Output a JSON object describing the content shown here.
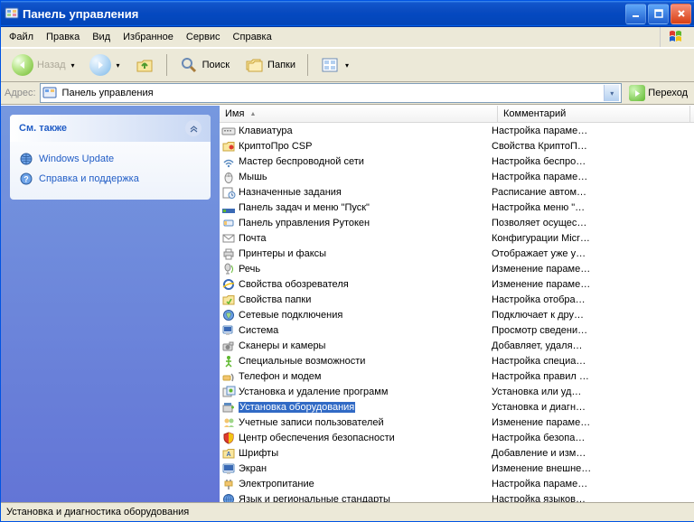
{
  "window": {
    "title": "Панель управления"
  },
  "menubar": [
    "Файл",
    "Правка",
    "Вид",
    "Избранное",
    "Сервис",
    "Справка"
  ],
  "toolbar": {
    "back": "Назад",
    "search": "Поиск",
    "folders": "Папки"
  },
  "addressbar": {
    "label": "Адрес:",
    "value": "Панель управления",
    "go": "Переход"
  },
  "sidebar": {
    "panel": {
      "title": "См. также",
      "links": [
        {
          "label": "Windows Update",
          "icon": "globe"
        },
        {
          "label": "Справка и поддержка",
          "icon": "help"
        }
      ]
    }
  },
  "columns": {
    "name": "Имя",
    "comment": "Комментарий",
    "name_w": 295,
    "comment_w": 200
  },
  "selected_index": 18,
  "items": [
    {
      "name": "Клавиатура",
      "comment": "Настройка параме…",
      "icon": "keyboard"
    },
    {
      "name": "КриптоПро CSP",
      "comment": "Свойства КриптоП…",
      "icon": "folder-cert"
    },
    {
      "name": "Мастер беспроводной сети",
      "comment": "Настройка беспро…",
      "icon": "wifi"
    },
    {
      "name": "Мышь",
      "comment": "Настройка параме…",
      "icon": "mouse"
    },
    {
      "name": "Назначенные задания",
      "comment": "Расписание автом…",
      "icon": "tasks"
    },
    {
      "name": "Панель задач и меню \"Пуск\"",
      "comment": "Настройка меню \"…",
      "icon": "taskbar"
    },
    {
      "name": "Панель управления Рутокен",
      "comment": "Позволяет осущес…",
      "icon": "rutoken"
    },
    {
      "name": "Почта",
      "comment": "Конфигурации Micr…",
      "icon": "mail"
    },
    {
      "name": "Принтеры и факсы",
      "comment": "Отображает уже у…",
      "icon": "printer"
    },
    {
      "name": "Речь",
      "comment": "Изменение параме…",
      "icon": "speech"
    },
    {
      "name": "Свойства обозревателя",
      "comment": "Изменение параме…",
      "icon": "ie"
    },
    {
      "name": "Свойства папки",
      "comment": "Настройка отобра…",
      "icon": "folder-opt"
    },
    {
      "name": "Сетевые подключения",
      "comment": "Подключает к дру…",
      "icon": "network"
    },
    {
      "name": "Система",
      "comment": "Просмотр сведени…",
      "icon": "system"
    },
    {
      "name": "Сканеры и камеры",
      "comment": "Добавляет, удаля…",
      "icon": "camera"
    },
    {
      "name": "Специальные возможности",
      "comment": "Настройка специа…",
      "icon": "access"
    },
    {
      "name": "Телефон и модем",
      "comment": "Настройка правил …",
      "icon": "phone"
    },
    {
      "name": "Установка и удаление программ",
      "comment": "Установка или уд…",
      "icon": "addrem"
    },
    {
      "name": "Установка оборудования",
      "comment": "Установка и диагн…",
      "icon": "addhw"
    },
    {
      "name": "Учетные записи пользователей",
      "comment": "Изменение параме…",
      "icon": "users"
    },
    {
      "name": "Центр обеспечения безопасности",
      "comment": "Настройка безопа…",
      "icon": "security"
    },
    {
      "name": "Шрифты",
      "comment": "Добавление и изм…",
      "icon": "fonts"
    },
    {
      "name": "Экран",
      "comment": "Изменение внешне…",
      "icon": "display"
    },
    {
      "name": "Электропитание",
      "comment": "Настройка параме…",
      "icon": "power"
    },
    {
      "name": "Язык и региональные стандарты",
      "comment": "Настройка языков…",
      "icon": "regional"
    }
  ],
  "statusbar": "Установка и диагностика оборудования"
}
